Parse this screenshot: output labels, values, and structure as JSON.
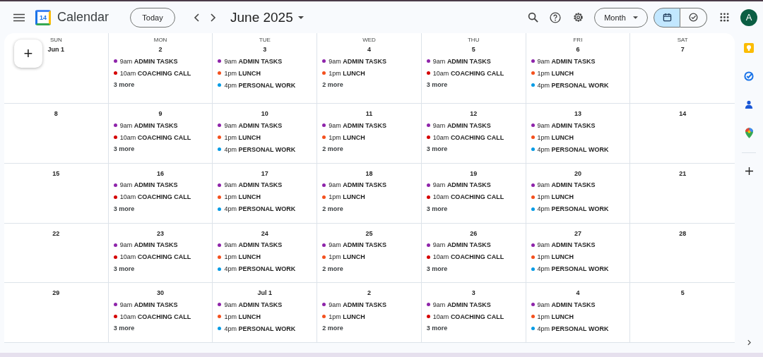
{
  "header": {
    "app_name": "Calendar",
    "logo_day": "14",
    "today_button": "Today",
    "period": "June 2025",
    "view_select": "Month",
    "avatar_initial": "A",
    "view_switch": [
      {
        "kind": "calendar",
        "selected": true
      },
      {
        "kind": "tasks",
        "selected": false
      }
    ]
  },
  "weekdays": [
    "SUN",
    "MON",
    "TUE",
    "WED",
    "THU",
    "FRI",
    "SAT"
  ],
  "create_button": "+",
  "weeks": [
    [
      {
        "date": "Jun 1"
      },
      {
        "date": "2",
        "events": [
          {
            "time": "9am",
            "title": "ADMIN TASKS",
            "color": "#8e24aa"
          },
          {
            "time": "10am",
            "title": "COACHING CALL",
            "color": "#d50000"
          }
        ],
        "more": "3 more"
      },
      {
        "date": "3",
        "events": [
          {
            "time": "9am",
            "title": "ADMIN TASKS",
            "color": "#8e24aa"
          },
          {
            "time": "1pm",
            "title": "LUNCH",
            "color": "#f4511e"
          },
          {
            "time": "4pm",
            "title": "PERSONAL WORK",
            "color": "#039be5"
          }
        ]
      },
      {
        "date": "4",
        "events": [
          {
            "time": "9am",
            "title": "ADMIN TASKS",
            "color": "#8e24aa"
          },
          {
            "time": "1pm",
            "title": "LUNCH",
            "color": "#f4511e"
          }
        ],
        "more": "2 more"
      },
      {
        "date": "5",
        "events": [
          {
            "time": "9am",
            "title": "ADMIN TASKS",
            "color": "#8e24aa"
          },
          {
            "time": "10am",
            "title": "COACHING CALL",
            "color": "#d50000"
          }
        ],
        "more": "3 more"
      },
      {
        "date": "6",
        "events": [
          {
            "time": "9am",
            "title": "ADMIN TASKS",
            "color": "#8e24aa"
          },
          {
            "time": "1pm",
            "title": "LUNCH",
            "color": "#f4511e"
          },
          {
            "time": "4pm",
            "title": "PERSONAL WORK",
            "color": "#039be5"
          }
        ]
      },
      {
        "date": "7"
      }
    ],
    [
      {
        "date": "8"
      },
      {
        "date": "9",
        "events": [
          {
            "time": "9am",
            "title": "ADMIN TASKS",
            "color": "#8e24aa"
          },
          {
            "time": "10am",
            "title": "COACHING CALL",
            "color": "#d50000"
          }
        ],
        "more": "3 more"
      },
      {
        "date": "10",
        "events": [
          {
            "time": "9am",
            "title": "ADMIN TASKS",
            "color": "#8e24aa"
          },
          {
            "time": "1pm",
            "title": "LUNCH",
            "color": "#f4511e"
          },
          {
            "time": "4pm",
            "title": "PERSONAL WORK",
            "color": "#039be5"
          }
        ]
      },
      {
        "date": "11",
        "events": [
          {
            "time": "9am",
            "title": "ADMIN TASKS",
            "color": "#8e24aa"
          },
          {
            "time": "1pm",
            "title": "LUNCH",
            "color": "#f4511e"
          }
        ],
        "more": "2 more"
      },
      {
        "date": "12",
        "events": [
          {
            "time": "9am",
            "title": "ADMIN TASKS",
            "color": "#8e24aa"
          },
          {
            "time": "10am",
            "title": "COACHING CALL",
            "color": "#d50000"
          }
        ],
        "more": "3 more"
      },
      {
        "date": "13",
        "events": [
          {
            "time": "9am",
            "title": "ADMIN TASKS",
            "color": "#8e24aa"
          },
          {
            "time": "1pm",
            "title": "LUNCH",
            "color": "#f4511e"
          },
          {
            "time": "4pm",
            "title": "PERSONAL WORK",
            "color": "#039be5"
          }
        ]
      },
      {
        "date": "14"
      }
    ],
    [
      {
        "date": "15"
      },
      {
        "date": "16",
        "events": [
          {
            "time": "9am",
            "title": "ADMIN TASKS",
            "color": "#8e24aa"
          },
          {
            "time": "10am",
            "title": "COACHING CALL",
            "color": "#d50000"
          }
        ],
        "more": "3 more"
      },
      {
        "date": "17",
        "events": [
          {
            "time": "9am",
            "title": "ADMIN TASKS",
            "color": "#8e24aa"
          },
          {
            "time": "1pm",
            "title": "LUNCH",
            "color": "#f4511e"
          },
          {
            "time": "4pm",
            "title": "PERSONAL WORK",
            "color": "#039be5"
          }
        ]
      },
      {
        "date": "18",
        "events": [
          {
            "time": "9am",
            "title": "ADMIN TASKS",
            "color": "#8e24aa"
          },
          {
            "time": "1pm",
            "title": "LUNCH",
            "color": "#f4511e"
          }
        ],
        "more": "2 more"
      },
      {
        "date": "19",
        "events": [
          {
            "time": "9am",
            "title": "ADMIN TASKS",
            "color": "#8e24aa"
          },
          {
            "time": "10am",
            "title": "COACHING CALL",
            "color": "#d50000"
          }
        ],
        "more": "3 more"
      },
      {
        "date": "20",
        "events": [
          {
            "time": "9am",
            "title": "ADMIN TASKS",
            "color": "#8e24aa"
          },
          {
            "time": "1pm",
            "title": "LUNCH",
            "color": "#f4511e"
          },
          {
            "time": "4pm",
            "title": "PERSONAL WORK",
            "color": "#039be5"
          }
        ]
      },
      {
        "date": "21"
      }
    ],
    [
      {
        "date": "22"
      },
      {
        "date": "23",
        "events": [
          {
            "time": "9am",
            "title": "ADMIN TASKS",
            "color": "#8e24aa"
          },
          {
            "time": "10am",
            "title": "COACHING CALL",
            "color": "#d50000"
          }
        ],
        "more": "3 more"
      },
      {
        "date": "24",
        "events": [
          {
            "time": "9am",
            "title": "ADMIN TASKS",
            "color": "#8e24aa"
          },
          {
            "time": "1pm",
            "title": "LUNCH",
            "color": "#f4511e"
          },
          {
            "time": "4pm",
            "title": "PERSONAL WORK",
            "color": "#039be5"
          }
        ]
      },
      {
        "date": "25",
        "events": [
          {
            "time": "9am",
            "title": "ADMIN TASKS",
            "color": "#8e24aa"
          },
          {
            "time": "1pm",
            "title": "LUNCH",
            "color": "#f4511e"
          }
        ],
        "more": "2 more"
      },
      {
        "date": "26",
        "events": [
          {
            "time": "9am",
            "title": "ADMIN TASKS",
            "color": "#8e24aa"
          },
          {
            "time": "10am",
            "title": "COACHING CALL",
            "color": "#d50000"
          }
        ],
        "more": "3 more"
      },
      {
        "date": "27",
        "events": [
          {
            "time": "9am",
            "title": "ADMIN TASKS",
            "color": "#8e24aa"
          },
          {
            "time": "1pm",
            "title": "LUNCH",
            "color": "#f4511e"
          },
          {
            "time": "4pm",
            "title": "PERSONAL WORK",
            "color": "#039be5"
          }
        ]
      },
      {
        "date": "28"
      }
    ],
    [
      {
        "date": "29"
      },
      {
        "date": "30",
        "events": [
          {
            "time": "9am",
            "title": "ADMIN TASKS",
            "color": "#8e24aa"
          },
          {
            "time": "10am",
            "title": "COACHING CALL",
            "color": "#d50000"
          }
        ],
        "more": "3 more"
      },
      {
        "date": "Jul 1",
        "events": [
          {
            "time": "9am",
            "title": "ADMIN TASKS",
            "color": "#8e24aa"
          },
          {
            "time": "1pm",
            "title": "LUNCH",
            "color": "#f4511e"
          },
          {
            "time": "4pm",
            "title": "PERSONAL WORK",
            "color": "#039be5"
          }
        ]
      },
      {
        "date": "2",
        "events": [
          {
            "time": "9am",
            "title": "ADMIN TASKS",
            "color": "#8e24aa"
          },
          {
            "time": "1pm",
            "title": "LUNCH",
            "color": "#f4511e"
          }
        ],
        "more": "2 more"
      },
      {
        "date": "3",
        "events": [
          {
            "time": "9am",
            "title": "ADMIN TASKS",
            "color": "#8e24aa"
          },
          {
            "time": "10am",
            "title": "COACHING CALL",
            "color": "#d50000"
          }
        ],
        "more": "3 more"
      },
      {
        "date": "4",
        "events": [
          {
            "time": "9am",
            "title": "ADMIN TASKS",
            "color": "#8e24aa"
          },
          {
            "time": "1pm",
            "title": "LUNCH",
            "color": "#f4511e"
          },
          {
            "time": "4pm",
            "title": "PERSONAL WORK",
            "color": "#039be5"
          }
        ]
      },
      {
        "date": "5"
      }
    ]
  ]
}
